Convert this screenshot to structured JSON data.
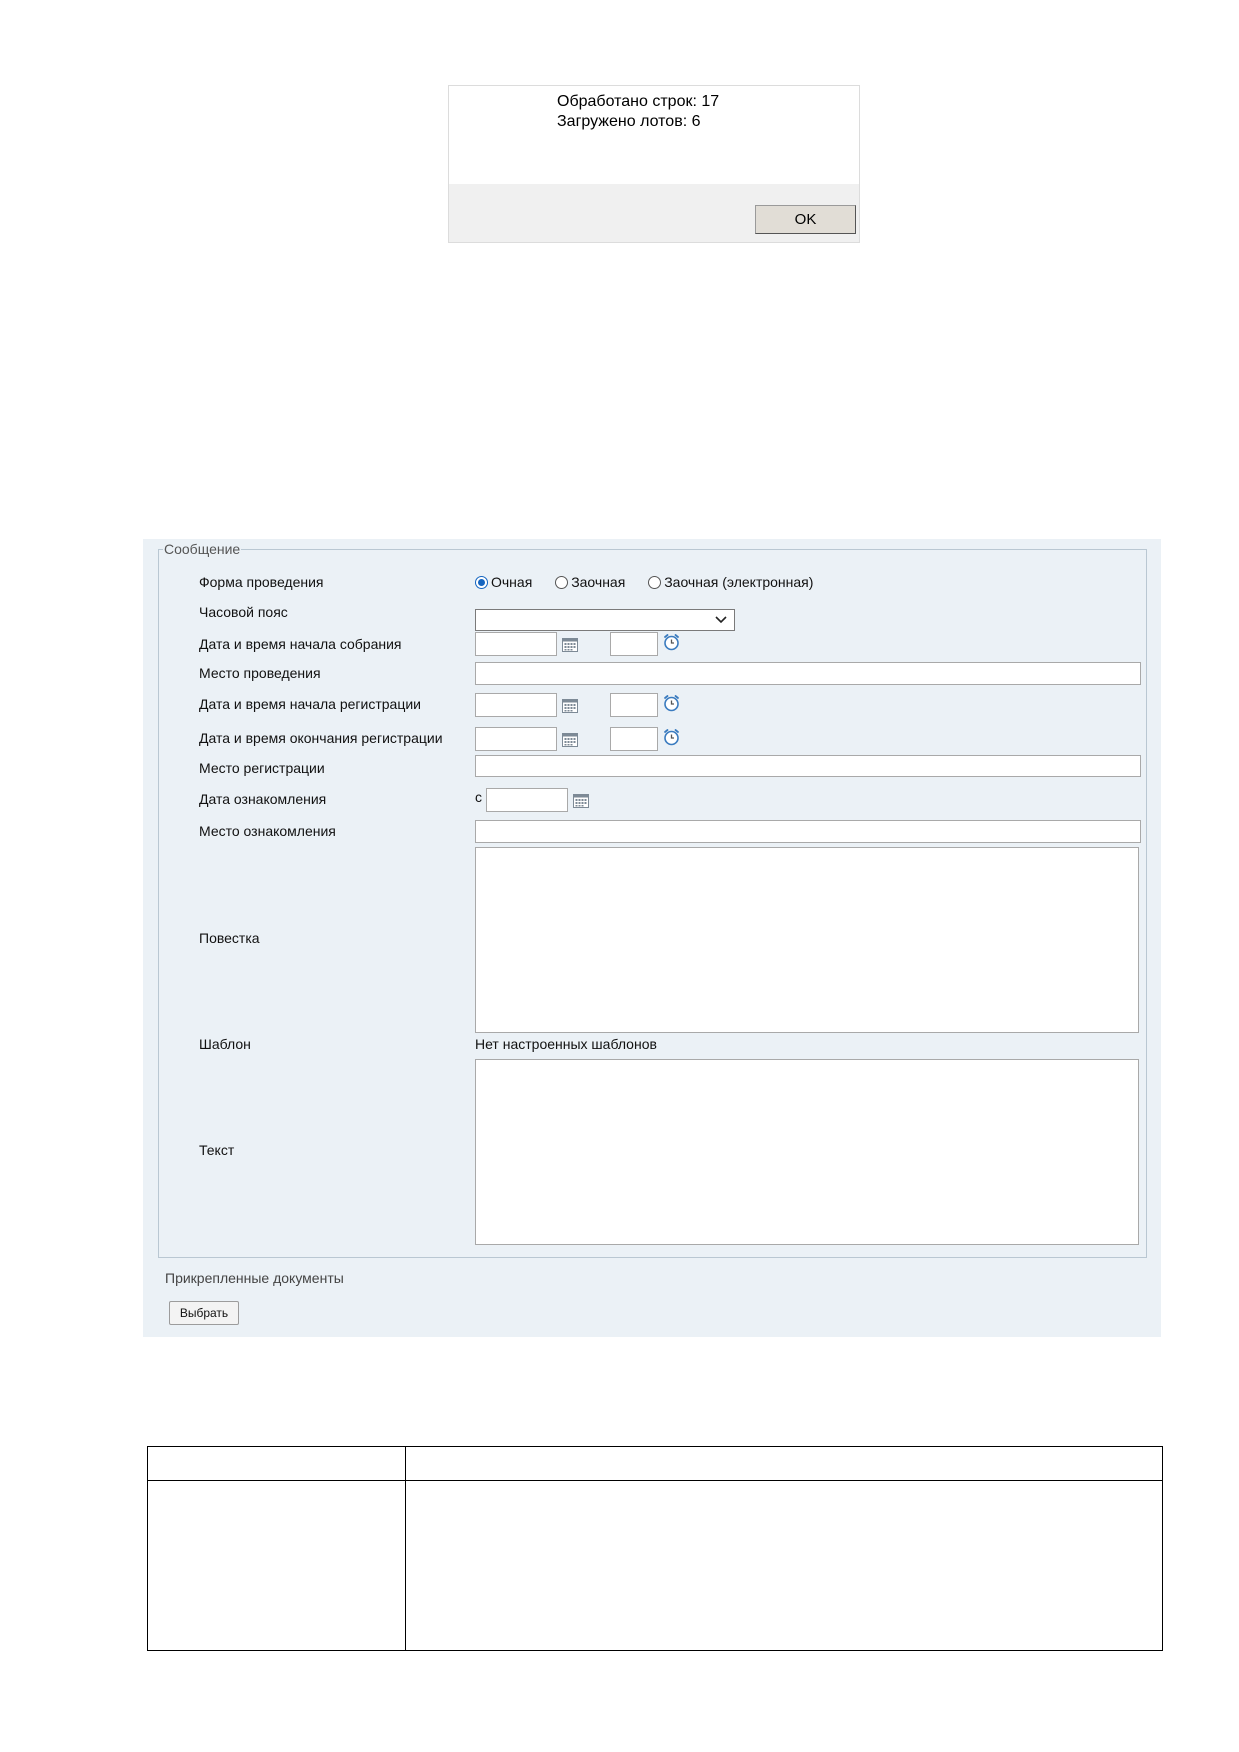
{
  "dialog": {
    "lines": [
      "Обработано строк: 17",
      "Загружено лотов: 6"
    ],
    "ok_label": "OK"
  },
  "form": {
    "legend": "Сообщение",
    "labels": {
      "format": "Форма проведения",
      "timezone": "Часовой пояс",
      "meeting_start": "Дата и время начала собрания",
      "venue": "Место проведения",
      "registration_start": "Дата и время начала регистрации",
      "registration_end": "Дата и время окончания регистрации",
      "registration_place": "Место регистрации",
      "review_date": "Дата ознакомления",
      "review_place": "Место ознакомления",
      "agenda": "Повестка",
      "template": "Шаблон",
      "text": "Текст"
    },
    "format_options": [
      {
        "label": "Очная",
        "checked": true
      },
      {
        "label": "Заочная",
        "checked": false
      },
      {
        "label": "Заочная (электронная)",
        "checked": false
      }
    ],
    "timezone_value": "",
    "review_date_prefix": "с",
    "template_value": "Нет настроенных шаблонов",
    "attached_docs_label": "Прикрепленные документы",
    "choose_button_label": "Выбрать"
  },
  "colors": {
    "panel_bg": "#ebf1f6",
    "radio_accent": "#1565c0",
    "icon_gray": "#7d8a96",
    "clock_accent": "#3a7bbf"
  },
  "icons": [
    "calendar-icon",
    "clock-icon",
    "chevron-down-icon"
  ]
}
